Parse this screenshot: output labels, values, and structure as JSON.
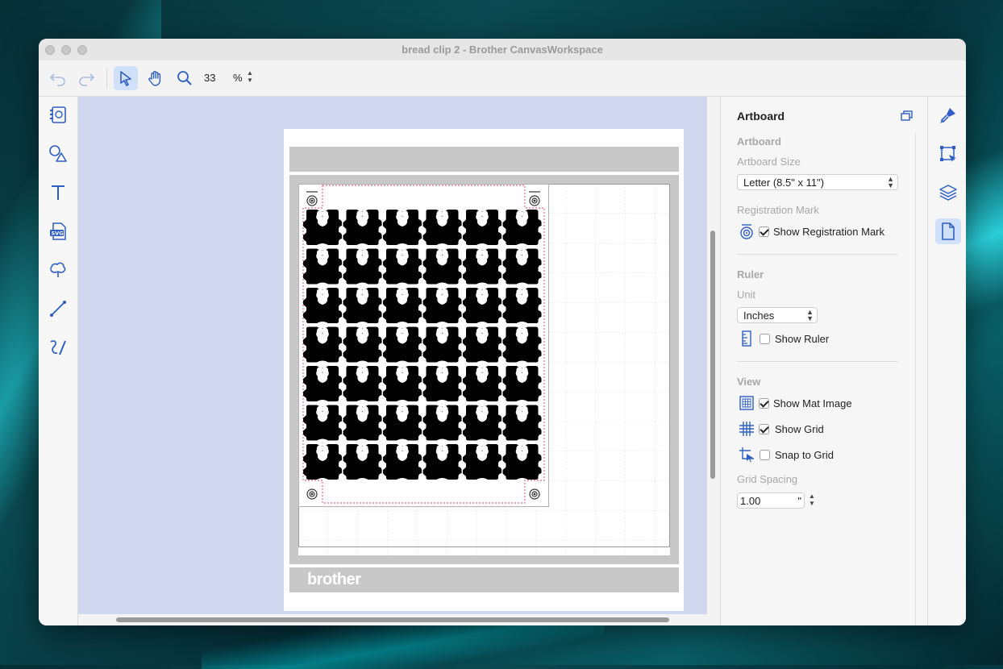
{
  "window": {
    "title": "bread clip 2 - Brother CanvasWorkspace"
  },
  "toolbar": {
    "zoom_value": "33",
    "zoom_unit": "%"
  },
  "panel": {
    "title": "Artboard",
    "artboard_section": "Artboard",
    "artboard_size_label": "Artboard Size",
    "artboard_size_value": "Letter (8.5\" x 11\")",
    "registration_label": "Registration Mark",
    "show_registration": "Show Registration Mark",
    "show_registration_checked": true,
    "ruler_section": "Ruler",
    "unit_label": "Unit",
    "unit_value": "Inches",
    "show_ruler": "Show Ruler",
    "show_ruler_checked": false,
    "view_section": "View",
    "show_mat_image": "Show Mat Image",
    "show_mat_image_checked": true,
    "show_grid": "Show Grid",
    "show_grid_checked": true,
    "snap_to_grid": "Snap to Grid",
    "snap_to_grid_checked": false,
    "grid_spacing_label": "Grid Spacing",
    "grid_spacing_value": "1.00",
    "grid_spacing_unit": "\""
  },
  "mat": {
    "brand": "brother"
  },
  "design": {
    "rows": 7,
    "cols": 6
  },
  "colors": {
    "accent": "#3a6fd8",
    "canvas_bg": "#cfd8ee",
    "cut_line": "#e0406a"
  }
}
